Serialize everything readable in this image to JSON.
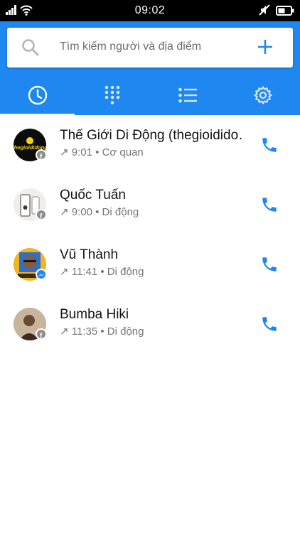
{
  "status_bar": {
    "time": "09:02"
  },
  "search": {
    "placeholder": "Tìm kiếm người và địa điểm"
  },
  "tabs": [
    {
      "id": "recent",
      "icon": "clock-icon",
      "active": true
    },
    {
      "id": "dialpad",
      "icon": "dialpad-icon",
      "active": false
    },
    {
      "id": "contacts",
      "icon": "list-icon",
      "active": false
    },
    {
      "id": "settings",
      "icon": "gear-icon",
      "active": false
    }
  ],
  "calls": [
    {
      "name": "Thế Giới Di Động (thegioidido…",
      "direction": "↗",
      "time": "9:01",
      "label": "Cơ quan",
      "source": "facebook",
      "avatar_text": "thegioididong"
    },
    {
      "name": "Quốc Tuấn",
      "direction": "↗",
      "time": "9:00",
      "label": "Di động",
      "source": "facebook"
    },
    {
      "name": "Vũ Thành",
      "direction": "↗",
      "time": "11:41",
      "label": "Di động",
      "source": "messenger"
    },
    {
      "name": "Bumba Hiki",
      "direction": "↗",
      "time": "11:35",
      "label": "Di động",
      "source": "facebook"
    }
  ],
  "colors": {
    "brand": "#1e88f0",
    "call": "#1e88f0"
  }
}
